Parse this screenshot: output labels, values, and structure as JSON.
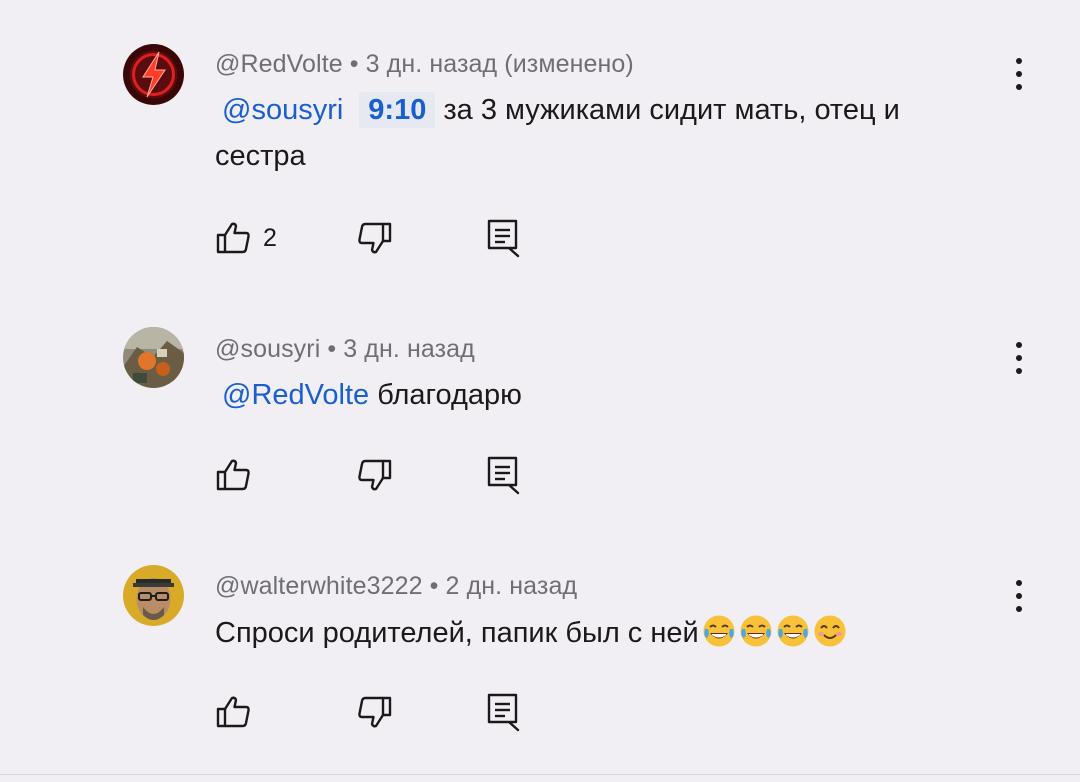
{
  "comments": [
    {
      "author": "@RedVolte",
      "sep": "•",
      "age": "3 дн. назад (изменено)",
      "mention": "@sousyri",
      "timestamp": "9:10",
      "text": "за 3 мужиками сидит мать, отец и сестра",
      "likes": "2",
      "avatar_icon": "lightning-avatar"
    },
    {
      "author": "@sousyri",
      "sep": "•",
      "age": "3 дн. назад",
      "mention": "@RedVolte",
      "text": "благодарю",
      "likes": "",
      "avatar_icon": "landscape-avatar"
    },
    {
      "author": "@walterwhite3222",
      "sep": "•",
      "age": "2 дн. назад",
      "text": "Спроси родителей, папик был с ней",
      "emojis": [
        "face-with-tears-of-joy",
        "face-with-tears-of-joy",
        "face-with-tears-of-joy",
        "smiling-face-with-smiling-eyes"
      ],
      "likes": "",
      "avatar_icon": "man-with-glasses-avatar"
    }
  ],
  "icons": {
    "like": "thumbs-up-icon",
    "dislike": "thumbs-down-icon",
    "reply": "reply-icon",
    "more": "more-vert-icon"
  },
  "colors": {
    "background": "#f1eff3",
    "link": "#1a5fd0",
    "meta_text": "#6f6f73",
    "text": "#1a1a1a",
    "timestamp_bg": "#e6e9f1"
  }
}
